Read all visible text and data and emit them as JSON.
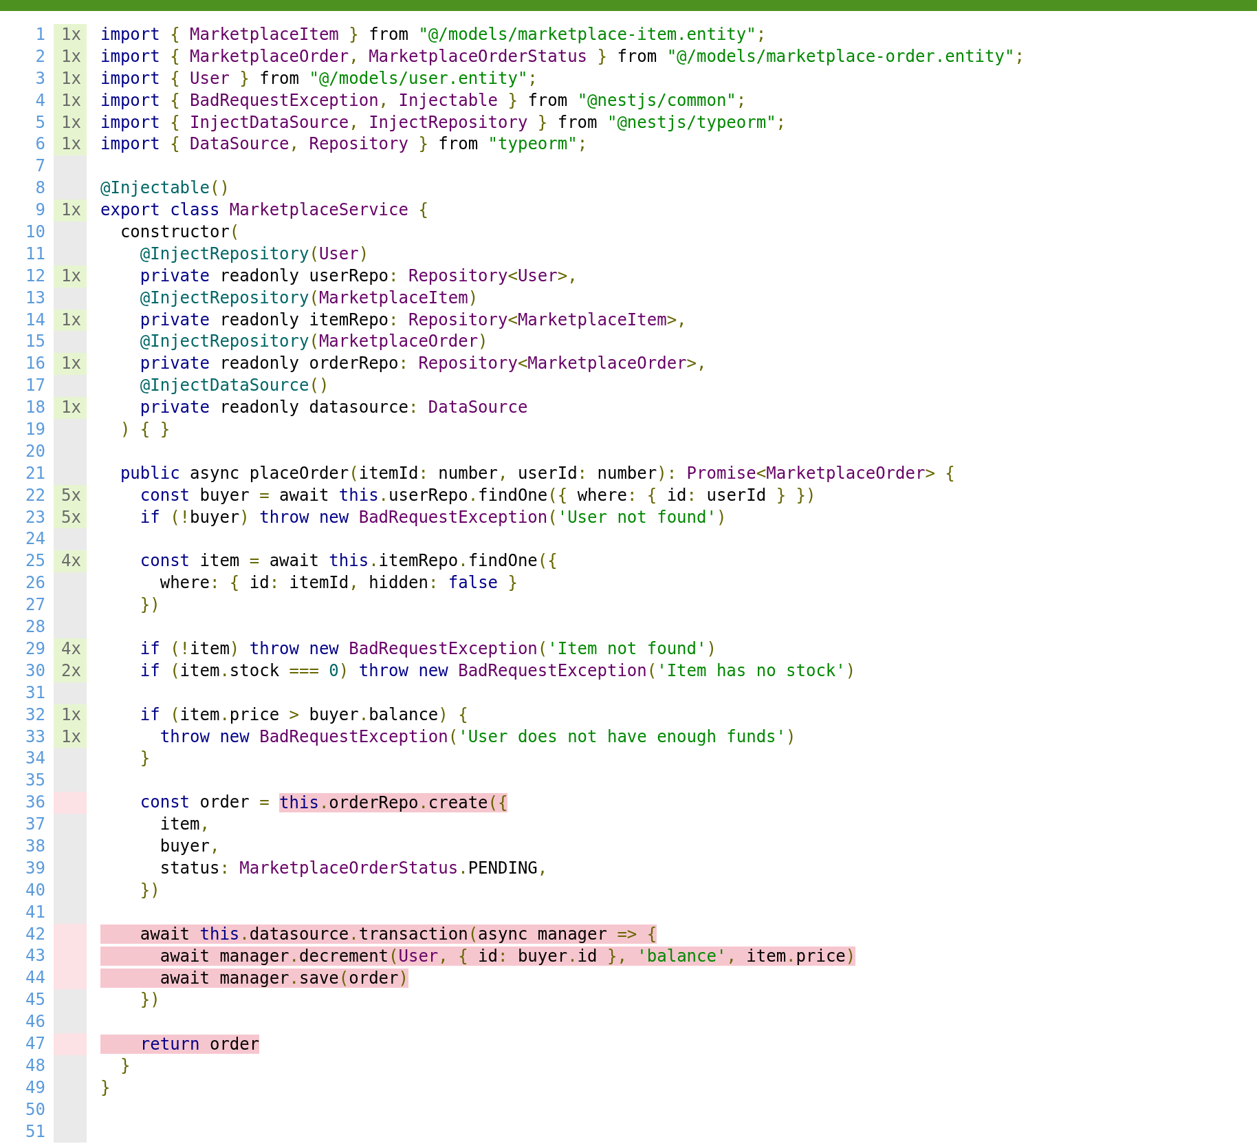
{
  "lines": [
    {
      "number": "1",
      "hits": "1x",
      "kind": "covered",
      "code": [
        {
          "kind": "kw",
          "text": "import "
        },
        {
          "kind": "pun",
          "text": "{ "
        },
        {
          "kind": "type",
          "text": "MarketplaceItem "
        },
        {
          "kind": "pun",
          "text": "} "
        },
        {
          "kind": "pln",
          "text": "from "
        },
        {
          "kind": "str",
          "text": "\"@/models/marketplace-item.entity\""
        },
        {
          "kind": "pun",
          "text": ";"
        }
      ]
    },
    {
      "number": "2",
      "hits": "1x",
      "kind": "covered",
      "code": [
        {
          "kind": "kw",
          "text": "import "
        },
        {
          "kind": "pun",
          "text": "{ "
        },
        {
          "kind": "type",
          "text": "MarketplaceOrder"
        },
        {
          "kind": "pun",
          "text": ", "
        },
        {
          "kind": "type",
          "text": "MarketplaceOrderStatus "
        },
        {
          "kind": "pun",
          "text": "} "
        },
        {
          "kind": "pln",
          "text": "from "
        },
        {
          "kind": "str",
          "text": "\"@/models/marketplace-order.entity\""
        },
        {
          "kind": "pun",
          "text": ";"
        }
      ]
    },
    {
      "number": "3",
      "hits": "1x",
      "kind": "covered",
      "code": [
        {
          "kind": "kw",
          "text": "import "
        },
        {
          "kind": "pun",
          "text": "{ "
        },
        {
          "kind": "type",
          "text": "User "
        },
        {
          "kind": "pun",
          "text": "} "
        },
        {
          "kind": "pln",
          "text": "from "
        },
        {
          "kind": "str",
          "text": "\"@/models/user.entity\""
        },
        {
          "kind": "pun",
          "text": ";"
        }
      ]
    },
    {
      "number": "4",
      "hits": "1x",
      "kind": "covered",
      "code": [
        {
          "kind": "kw",
          "text": "import "
        },
        {
          "kind": "pun",
          "text": "{ "
        },
        {
          "kind": "type",
          "text": "BadRequestException"
        },
        {
          "kind": "pun",
          "text": ", "
        },
        {
          "kind": "type",
          "text": "Injectable "
        },
        {
          "kind": "pun",
          "text": "} "
        },
        {
          "kind": "pln",
          "text": "from "
        },
        {
          "kind": "str",
          "text": "\"@nestjs/common\""
        },
        {
          "kind": "pun",
          "text": ";"
        }
      ]
    },
    {
      "number": "5",
      "hits": "1x",
      "kind": "covered",
      "code": [
        {
          "kind": "kw",
          "text": "import "
        },
        {
          "kind": "pun",
          "text": "{ "
        },
        {
          "kind": "type",
          "text": "InjectDataSource"
        },
        {
          "kind": "pun",
          "text": ", "
        },
        {
          "kind": "type",
          "text": "InjectRepository "
        },
        {
          "kind": "pun",
          "text": "} "
        },
        {
          "kind": "pln",
          "text": "from "
        },
        {
          "kind": "str",
          "text": "\"@nestjs/typeorm\""
        },
        {
          "kind": "pun",
          "text": ";"
        }
      ]
    },
    {
      "number": "6",
      "hits": "1x",
      "kind": "covered",
      "code": [
        {
          "kind": "kw",
          "text": "import "
        },
        {
          "kind": "pun",
          "text": "{ "
        },
        {
          "kind": "type",
          "text": "DataSource"
        },
        {
          "kind": "pun",
          "text": ", "
        },
        {
          "kind": "type",
          "text": "Repository "
        },
        {
          "kind": "pun",
          "text": "} "
        },
        {
          "kind": "pln",
          "text": "from "
        },
        {
          "kind": "str",
          "text": "\"typeorm\""
        },
        {
          "kind": "pun",
          "text": ";"
        }
      ]
    },
    {
      "number": "7",
      "kind": "neutral"
    },
    {
      "number": "8",
      "kind": "neutral",
      "code": [
        {
          "kind": "lit",
          "text": "@Injectable"
        },
        {
          "kind": "pun",
          "text": "()"
        }
      ]
    },
    {
      "number": "9",
      "hits": "1x",
      "kind": "covered",
      "code": [
        {
          "kind": "kw",
          "text": "export class "
        },
        {
          "kind": "type",
          "text": "MarketplaceService "
        },
        {
          "kind": "pun",
          "text": "{"
        }
      ]
    },
    {
      "number": "10",
      "kind": "neutral",
      "code": [
        {
          "kind": "pln",
          "text": "  constructor"
        },
        {
          "kind": "pun",
          "text": "("
        }
      ]
    },
    {
      "number": "11",
      "kind": "neutral",
      "code": [
        {
          "kind": "lit",
          "text": "    @InjectRepository"
        },
        {
          "kind": "pun",
          "text": "("
        },
        {
          "kind": "type",
          "text": "User"
        },
        {
          "kind": "pun",
          "text": ")"
        }
      ]
    },
    {
      "number": "12",
      "hits": "1x",
      "kind": "covered",
      "code": [
        {
          "kind": "kw",
          "text": "    private "
        },
        {
          "kind": "pln",
          "text": "readonly userRepo"
        },
        {
          "kind": "pun",
          "text": ": "
        },
        {
          "kind": "type",
          "text": "Repository"
        },
        {
          "kind": "pun",
          "text": "<"
        },
        {
          "kind": "type",
          "text": "User"
        },
        {
          "kind": "pun",
          "text": ">,"
        }
      ]
    },
    {
      "number": "13",
      "kind": "neutral",
      "code": [
        {
          "kind": "lit",
          "text": "    @InjectRepository"
        },
        {
          "kind": "pun",
          "text": "("
        },
        {
          "kind": "type",
          "text": "MarketplaceItem"
        },
        {
          "kind": "pun",
          "text": ")"
        }
      ]
    },
    {
      "number": "14",
      "hits": "1x",
      "kind": "covered",
      "code": [
        {
          "kind": "kw",
          "text": "    private "
        },
        {
          "kind": "pln",
          "text": "readonly itemRepo"
        },
        {
          "kind": "pun",
          "text": ": "
        },
        {
          "kind": "type",
          "text": "Repository"
        },
        {
          "kind": "pun",
          "text": "<"
        },
        {
          "kind": "type",
          "text": "MarketplaceItem"
        },
        {
          "kind": "pun",
          "text": ">,"
        }
      ]
    },
    {
      "number": "15",
      "kind": "neutral",
      "code": [
        {
          "kind": "lit",
          "text": "    @InjectRepository"
        },
        {
          "kind": "pun",
          "text": "("
        },
        {
          "kind": "type",
          "text": "MarketplaceOrder"
        },
        {
          "kind": "pun",
          "text": ")"
        }
      ]
    },
    {
      "number": "16",
      "hits": "1x",
      "kind": "covered",
      "code": [
        {
          "kind": "kw",
          "text": "    private "
        },
        {
          "kind": "pln",
          "text": "readonly orderRepo"
        },
        {
          "kind": "pun",
          "text": ": "
        },
        {
          "kind": "type",
          "text": "Repository"
        },
        {
          "kind": "pun",
          "text": "<"
        },
        {
          "kind": "type",
          "text": "MarketplaceOrder"
        },
        {
          "kind": "pun",
          "text": ">,"
        }
      ]
    },
    {
      "number": "17",
      "kind": "neutral",
      "code": [
        {
          "kind": "lit",
          "text": "    @InjectDataSource"
        },
        {
          "kind": "pun",
          "text": "()"
        }
      ]
    },
    {
      "number": "18",
      "hits": "1x",
      "kind": "covered",
      "code": [
        {
          "kind": "kw",
          "text": "    private "
        },
        {
          "kind": "pln",
          "text": "readonly datasource"
        },
        {
          "kind": "pun",
          "text": ": "
        },
        {
          "kind": "type",
          "text": "DataSource"
        }
      ]
    },
    {
      "number": "19",
      "kind": "neutral",
      "code": [
        {
          "kind": "pun",
          "text": "  ) { }"
        }
      ]
    },
    {
      "number": "20",
      "kind": "neutral"
    },
    {
      "number": "21",
      "kind": "neutral",
      "code": [
        {
          "kind": "kw",
          "text": "  public "
        },
        {
          "kind": "pln",
          "text": "async placeOrder"
        },
        {
          "kind": "pun",
          "text": "("
        },
        {
          "kind": "pln",
          "text": "itemId"
        },
        {
          "kind": "pun",
          "text": ": "
        },
        {
          "kind": "pln",
          "text": "number"
        },
        {
          "kind": "pun",
          "text": ", "
        },
        {
          "kind": "pln",
          "text": "userId"
        },
        {
          "kind": "pun",
          "text": ": "
        },
        {
          "kind": "pln",
          "text": "number"
        },
        {
          "kind": "pun",
          "text": "): "
        },
        {
          "kind": "type",
          "text": "Promise"
        },
        {
          "kind": "pun",
          "text": "<"
        },
        {
          "kind": "type",
          "text": "MarketplaceOrder"
        },
        {
          "kind": "pun",
          "text": "> {"
        }
      ]
    },
    {
      "number": "22",
      "hits": "5x",
      "kind": "covered",
      "code": [
        {
          "kind": "kw",
          "text": "    const "
        },
        {
          "kind": "pln",
          "text": "buyer "
        },
        {
          "kind": "pun",
          "text": "= "
        },
        {
          "kind": "pln",
          "text": "await "
        },
        {
          "kind": "kw",
          "text": "this"
        },
        {
          "kind": "pun",
          "text": "."
        },
        {
          "kind": "pln",
          "text": "userRepo"
        },
        {
          "kind": "pun",
          "text": "."
        },
        {
          "kind": "pln",
          "text": "findOne"
        },
        {
          "kind": "pun",
          "text": "({ "
        },
        {
          "kind": "pln",
          "text": "where"
        },
        {
          "kind": "pun",
          "text": ": { "
        },
        {
          "kind": "pln",
          "text": "id"
        },
        {
          "kind": "pun",
          "text": ": "
        },
        {
          "kind": "pln",
          "text": "userId "
        },
        {
          "kind": "pun",
          "text": "} })"
        }
      ]
    },
    {
      "number": "23",
      "hits": "5x",
      "kind": "covered",
      "code": [
        {
          "kind": "kw",
          "text": "    if "
        },
        {
          "kind": "pun",
          "text": "(!"
        },
        {
          "kind": "pln",
          "text": "buyer"
        },
        {
          "kind": "pun",
          "text": ") "
        },
        {
          "kind": "kw",
          "text": "throw new "
        },
        {
          "kind": "type",
          "text": "BadRequestException"
        },
        {
          "kind": "pun",
          "text": "("
        },
        {
          "kind": "str",
          "text": "'User not found'"
        },
        {
          "kind": "pun",
          "text": ")"
        }
      ]
    },
    {
      "number": "24",
      "kind": "neutral"
    },
    {
      "number": "25",
      "hits": "4x",
      "kind": "covered",
      "code": [
        {
          "kind": "kw",
          "text": "    const "
        },
        {
          "kind": "pln",
          "text": "item "
        },
        {
          "kind": "pun",
          "text": "= "
        },
        {
          "kind": "pln",
          "text": "await "
        },
        {
          "kind": "kw",
          "text": "this"
        },
        {
          "kind": "pun",
          "text": "."
        },
        {
          "kind": "pln",
          "text": "itemRepo"
        },
        {
          "kind": "pun",
          "text": "."
        },
        {
          "kind": "pln",
          "text": "findOne"
        },
        {
          "kind": "pun",
          "text": "({"
        }
      ]
    },
    {
      "number": "26",
      "kind": "neutral",
      "code": [
        {
          "kind": "pln",
          "text": "      where"
        },
        {
          "kind": "pun",
          "text": ": { "
        },
        {
          "kind": "pln",
          "text": "id"
        },
        {
          "kind": "pun",
          "text": ": "
        },
        {
          "kind": "pln",
          "text": "itemId"
        },
        {
          "kind": "pun",
          "text": ", "
        },
        {
          "kind": "pln",
          "text": "hidden"
        },
        {
          "kind": "pun",
          "text": ": "
        },
        {
          "kind": "kw",
          "text": "false "
        },
        {
          "kind": "pun",
          "text": "}"
        }
      ]
    },
    {
      "number": "27",
      "kind": "neutral",
      "code": [
        {
          "kind": "pun",
          "text": "    })"
        }
      ]
    },
    {
      "number": "28",
      "kind": "neutral"
    },
    {
      "number": "29",
      "hits": "4x",
      "kind": "covered",
      "code": [
        {
          "kind": "kw",
          "text": "    if "
        },
        {
          "kind": "pun",
          "text": "(!"
        },
        {
          "kind": "pln",
          "text": "item"
        },
        {
          "kind": "pun",
          "text": ") "
        },
        {
          "kind": "kw",
          "text": "throw new "
        },
        {
          "kind": "type",
          "text": "BadRequestException"
        },
        {
          "kind": "pun",
          "text": "("
        },
        {
          "kind": "str",
          "text": "'Item not found'"
        },
        {
          "kind": "pun",
          "text": ")"
        }
      ]
    },
    {
      "number": "30",
      "hits": "2x",
      "kind": "covered",
      "code": [
        {
          "kind": "kw",
          "text": "    if "
        },
        {
          "kind": "pun",
          "text": "("
        },
        {
          "kind": "pln",
          "text": "item"
        },
        {
          "kind": "pun",
          "text": "."
        },
        {
          "kind": "pln",
          "text": "stock "
        },
        {
          "kind": "pun",
          "text": "=== "
        },
        {
          "kind": "lit",
          "text": "0"
        },
        {
          "kind": "pun",
          "text": ") "
        },
        {
          "kind": "kw",
          "text": "throw new "
        },
        {
          "kind": "type",
          "text": "BadRequestException"
        },
        {
          "kind": "pun",
          "text": "("
        },
        {
          "kind": "str",
          "text": "'Item has no stock'"
        },
        {
          "kind": "pun",
          "text": ")"
        }
      ]
    },
    {
      "number": "31",
      "kind": "neutral"
    },
    {
      "number": "32",
      "hits": "1x",
      "kind": "covered",
      "code": [
        {
          "kind": "kw",
          "text": "    if "
        },
        {
          "kind": "pun",
          "text": "("
        },
        {
          "kind": "pln",
          "text": "item"
        },
        {
          "kind": "pun",
          "text": "."
        },
        {
          "kind": "pln",
          "text": "price "
        },
        {
          "kind": "pun",
          "text": "> "
        },
        {
          "kind": "pln",
          "text": "buyer"
        },
        {
          "kind": "pun",
          "text": "."
        },
        {
          "kind": "pln",
          "text": "balance"
        },
        {
          "kind": "pun",
          "text": ") {"
        }
      ]
    },
    {
      "number": "33",
      "hits": "1x",
      "kind": "covered",
      "code": [
        {
          "kind": "kw",
          "text": "      throw new "
        },
        {
          "kind": "type",
          "text": "BadRequestException"
        },
        {
          "kind": "pun",
          "text": "("
        },
        {
          "kind": "str",
          "text": "'User does not have enough funds'"
        },
        {
          "kind": "pun",
          "text": ")"
        }
      ]
    },
    {
      "number": "34",
      "kind": "neutral",
      "code": [
        {
          "kind": "pun",
          "text": "    }"
        }
      ]
    },
    {
      "number": "35",
      "kind": "neutral"
    },
    {
      "number": "36",
      "kind": "uncovered",
      "code": [
        {
          "kind": "kw",
          "text": "    const "
        },
        {
          "kind": "pln",
          "text": "order "
        },
        {
          "kind": "pun",
          "text": "= "
        }
      ],
      "uncovered_code": [
        {
          "kind": "kw",
          "text": "this"
        },
        {
          "kind": "pun",
          "text": "."
        },
        {
          "kind": "pln",
          "text": "orderRepo"
        },
        {
          "kind": "pun",
          "text": "."
        },
        {
          "kind": "pln",
          "text": "create"
        },
        {
          "kind": "pun",
          "text": "({"
        }
      ]
    },
    {
      "number": "37",
      "kind": "neutral",
      "code": [
        {
          "kind": "pln",
          "text": "      item"
        },
        {
          "kind": "pun",
          "text": ","
        }
      ]
    },
    {
      "number": "38",
      "kind": "neutral",
      "code": [
        {
          "kind": "pln",
          "text": "      buyer"
        },
        {
          "kind": "pun",
          "text": ","
        }
      ]
    },
    {
      "number": "39",
      "kind": "neutral",
      "code": [
        {
          "kind": "pln",
          "text": "      status"
        },
        {
          "kind": "pun",
          "text": ": "
        },
        {
          "kind": "type",
          "text": "MarketplaceOrderStatus"
        },
        {
          "kind": "pun",
          "text": "."
        },
        {
          "kind": "pln",
          "text": "PENDING"
        },
        {
          "kind": "pun",
          "text": ","
        }
      ]
    },
    {
      "number": "40",
      "kind": "neutral",
      "code": [
        {
          "kind": "pun",
          "text": "    })"
        }
      ]
    },
    {
      "number": "41",
      "kind": "neutral"
    },
    {
      "number": "42",
      "kind": "uncovered",
      "uncovered_code": [
        {
          "kind": "pln",
          "text": "    await "
        },
        {
          "kind": "kw",
          "text": "this"
        },
        {
          "kind": "pun",
          "text": "."
        },
        {
          "kind": "pln",
          "text": "datasource"
        },
        {
          "kind": "pun",
          "text": "."
        },
        {
          "kind": "pln",
          "text": "transaction"
        },
        {
          "kind": "pun",
          "text": "("
        },
        {
          "kind": "pln",
          "text": "async manager "
        },
        {
          "kind": "pun",
          "text": "=> {"
        }
      ]
    },
    {
      "number": "43",
      "kind": "uncovered",
      "uncovered_code": [
        {
          "kind": "pln",
          "text": "      await manager"
        },
        {
          "kind": "pun",
          "text": "."
        },
        {
          "kind": "pln",
          "text": "decrement"
        },
        {
          "kind": "pun",
          "text": "("
        },
        {
          "kind": "type",
          "text": "User"
        },
        {
          "kind": "pun",
          "text": ", { "
        },
        {
          "kind": "pln",
          "text": "id"
        },
        {
          "kind": "pun",
          "text": ": "
        },
        {
          "kind": "pln",
          "text": "buyer"
        },
        {
          "kind": "pun",
          "text": "."
        },
        {
          "kind": "pln",
          "text": "id "
        },
        {
          "kind": "pun",
          "text": "}, "
        },
        {
          "kind": "str",
          "text": "'balance'"
        },
        {
          "kind": "pun",
          "text": ", "
        },
        {
          "kind": "pln",
          "text": "item"
        },
        {
          "kind": "pun",
          "text": "."
        },
        {
          "kind": "pln",
          "text": "price"
        },
        {
          "kind": "pun",
          "text": ")"
        }
      ]
    },
    {
      "number": "44",
      "kind": "uncovered",
      "uncovered_code": [
        {
          "kind": "pln",
          "text": "      await manager"
        },
        {
          "kind": "pun",
          "text": "."
        },
        {
          "kind": "pln",
          "text": "save"
        },
        {
          "kind": "pun",
          "text": "("
        },
        {
          "kind": "pln",
          "text": "order"
        },
        {
          "kind": "pun",
          "text": ")"
        }
      ]
    },
    {
      "number": "45",
      "kind": "neutral",
      "code": [
        {
          "kind": "pun",
          "text": "    })"
        }
      ]
    },
    {
      "number": "46",
      "kind": "neutral"
    },
    {
      "number": "47",
      "kind": "uncovered",
      "uncovered_code": [
        {
          "kind": "kw",
          "text": "    return "
        },
        {
          "kind": "pln",
          "text": "order"
        }
      ]
    },
    {
      "number": "48",
      "kind": "neutral",
      "code": [
        {
          "kind": "pun",
          "text": "  }"
        }
      ]
    },
    {
      "number": "49",
      "kind": "neutral",
      "code": [
        {
          "kind": "pun",
          "text": "}"
        }
      ]
    },
    {
      "number": "50",
      "kind": "neutral"
    },
    {
      "number": "51",
      "kind": "neutral"
    }
  ]
}
